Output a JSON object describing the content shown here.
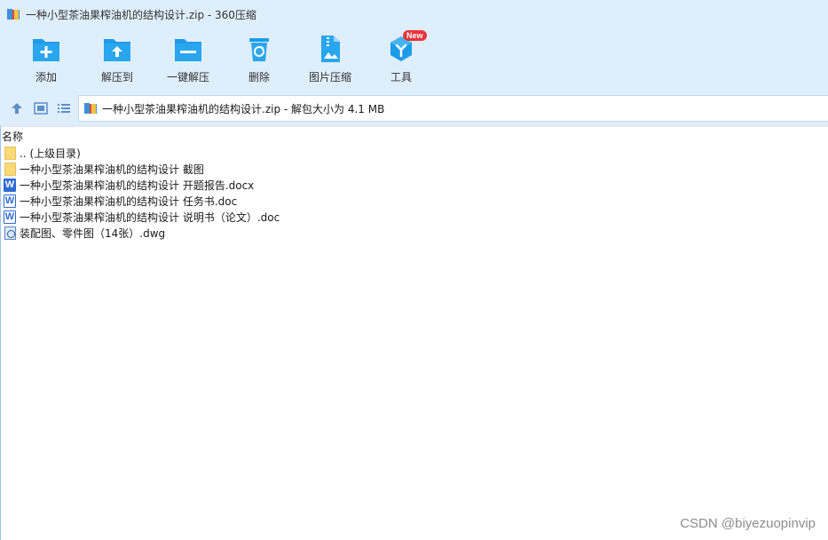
{
  "window": {
    "title": "一种小型茶油果榨油机的结构设计.zip - 360压缩"
  },
  "toolbar": {
    "items": [
      {
        "label": "添加",
        "icon": "add-folder-icon"
      },
      {
        "label": "解压到",
        "icon": "extract-to-icon"
      },
      {
        "label": "一键解压",
        "icon": "one-click-extract-icon"
      },
      {
        "label": "删除",
        "icon": "recycle-bin-icon"
      },
      {
        "label": "图片压缩",
        "icon": "image-compress-icon"
      },
      {
        "label": "工具",
        "icon": "tools-cube-icon",
        "badge": "New"
      }
    ]
  },
  "address": {
    "text": "一种小型茶油果榨油机的结构设计.zip - 解包大小为 4.1 MB"
  },
  "filelist": {
    "column_name": "名称",
    "rows": [
      {
        "name": ".. (上级目录)",
        "type": "folder"
      },
      {
        "name": "一种小型茶油果榨油机的结构设计 截图",
        "type": "folder"
      },
      {
        "name": "一种小型茶油果榨油机的结构设计 开题报告.docx",
        "type": "docx"
      },
      {
        "name": "一种小型茶油果榨油机的结构设计 任务书.doc",
        "type": "doc"
      },
      {
        "name": "一种小型茶油果榨油机的结构设计 说明书（论文）.doc",
        "type": "doc"
      },
      {
        "name": "装配图、零件图（14张）.dwg",
        "type": "dwg"
      }
    ]
  },
  "watermark": "CSDN @biyezuopinvip",
  "colors": {
    "chrome_bg": "#dfeefb",
    "accent_blue": "#1e9be8",
    "badge_red": "#e8343b"
  }
}
